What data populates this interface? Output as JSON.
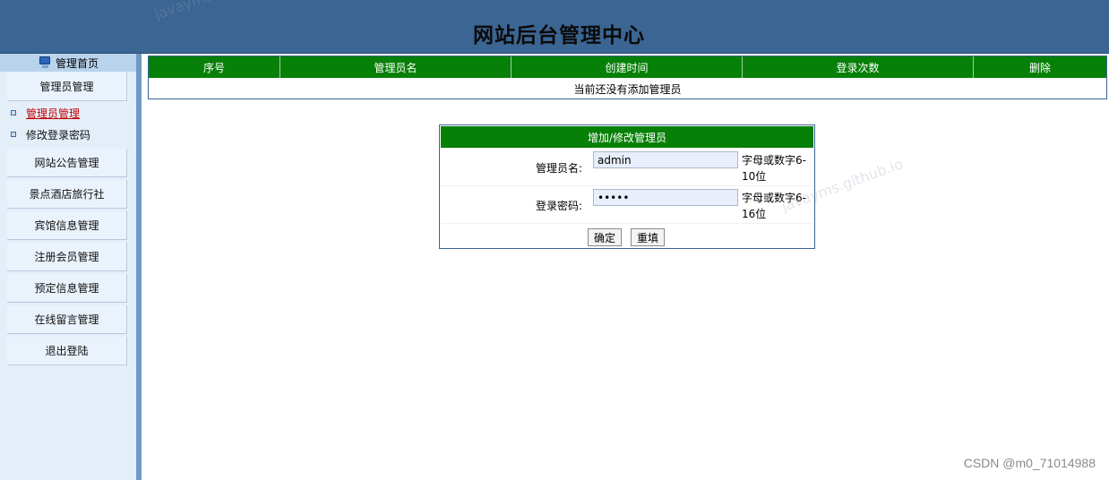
{
  "header": {
    "title": "网站后台管理中心"
  },
  "sidebar": {
    "home_label": "管理首页",
    "menu": [
      {
        "label": "管理员管理"
      },
      {
        "label": "网站公告管理"
      },
      {
        "label": "景点酒店旅行社"
      },
      {
        "label": "宾馆信息管理"
      },
      {
        "label": "注册会员管理"
      },
      {
        "label": "预定信息管理"
      },
      {
        "label": "在线留言管理"
      },
      {
        "label": "退出登陆"
      }
    ],
    "sub_items": [
      {
        "label": "管理员管理",
        "active": true
      },
      {
        "label": "修改登录密码",
        "active": false
      }
    ]
  },
  "admin_table": {
    "columns": [
      "序号",
      "管理员名",
      "创建时间",
      "登录次数",
      "删除"
    ],
    "empty_message": "当前还没有添加管理员"
  },
  "form": {
    "title": "增加/修改管理员",
    "username_label": "管理员名:",
    "username_value": "admin",
    "username_hint": "字母或数字6-10位",
    "password_label": "登录密码:",
    "password_value": "•••••",
    "password_hint": "字母或数字6-16位",
    "submit_label": "确定",
    "reset_label": "重填"
  },
  "watermark": {
    "text1": "javayms.github.io",
    "text2": "javayms.github.io",
    "csdn": "CSDN @m0_71014988"
  },
  "colors": {
    "header_bg": "#3b6593",
    "table_header_bg": "#078007",
    "sidebar_bg": "#e4eef9",
    "active_link": "#c00000"
  }
}
